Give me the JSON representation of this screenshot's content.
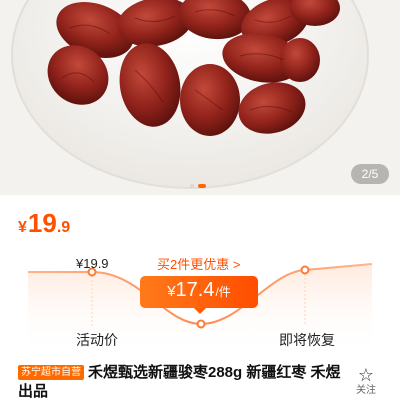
{
  "gallery": {
    "image": "red-dates-bowl",
    "page_indicator": "2/5",
    "dots": 2,
    "active_dot": 1
  },
  "price": {
    "currency": "¥",
    "integer": "19",
    "decimal": ".9",
    "color": "#ff5000"
  },
  "price_trend": {
    "original_price": "¥19.9",
    "promo_link": "买2件更优惠 >",
    "promo_tag": {
      "currency": "¥",
      "value": "17.4",
      "unit": "/件"
    },
    "label_active": "活动价",
    "label_restore": "即将恢复"
  },
  "product": {
    "store_badge": "苏宁超市自营",
    "title": "禾煜甄选新疆骏枣288g 新疆红枣 禾煜出品"
  },
  "favorite": {
    "icon": "star-icon",
    "label": "关注"
  }
}
